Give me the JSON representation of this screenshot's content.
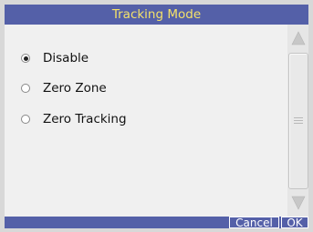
{
  "dialog": {
    "title": "Tracking Mode",
    "options": [
      {
        "label": "Disable",
        "selected": true
      },
      {
        "label": "Zero Zone",
        "selected": false
      },
      {
        "label": "Zero Tracking",
        "selected": false
      }
    ]
  },
  "footer": {
    "cancel_label": "Cancel",
    "ok_label": "OK"
  },
  "colors": {
    "titlebar_bg": "#5460a8",
    "title_text": "#f4e26a"
  },
  "icons": {
    "scroll_up": "triangle-up-icon",
    "scroll_down": "triangle-down-icon",
    "scroll_grip": "grip-lines-icon"
  }
}
